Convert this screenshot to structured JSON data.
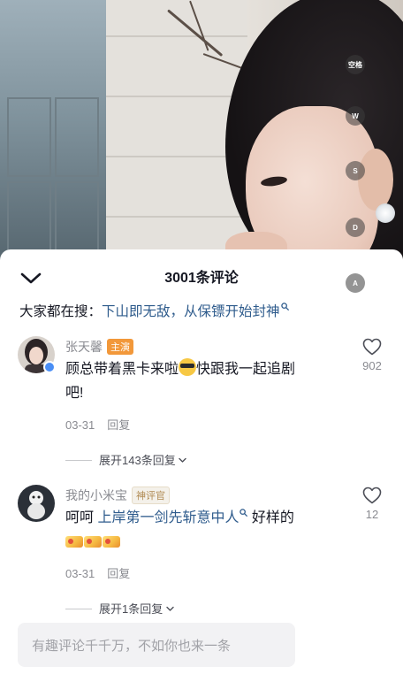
{
  "keyboard_hints": {
    "space": "空格",
    "w": "W",
    "s": "S",
    "d": "D",
    "a": "A"
  },
  "header": {
    "title": "3001条评论"
  },
  "search": {
    "prefix": "大家都在搜：",
    "query": "下山即无敌，从保镖开始封神"
  },
  "comments": [
    {
      "username": "张天馨",
      "tag": "主演",
      "text_before": "顾总带着黑卡来啦",
      "text_after": "快跟我一起追剧",
      "text_line2": "吧!",
      "date": "03-31",
      "reply_label": "回复",
      "likes": "902",
      "expand_label": "展开143条回复",
      "emoji": "sunglasses-emoji"
    },
    {
      "username": "我的小米宝",
      "tag": "神评官",
      "text_before": "呵呵 ",
      "link_text": "上岸第一剑先斩意中人",
      "text_after": " 好样的",
      "date": "03-31",
      "reply_label": "回复",
      "likes": "12",
      "expand_label": "展开1条回复",
      "emoji": "thumbs-up-emoji"
    }
  ],
  "input": {
    "placeholder": "有趣评论千千万，不如你也来一条"
  },
  "colors": {
    "link": "#2e5b8c",
    "tag_main": "#f2983a",
    "meta_gray": "#8a8b91"
  }
}
